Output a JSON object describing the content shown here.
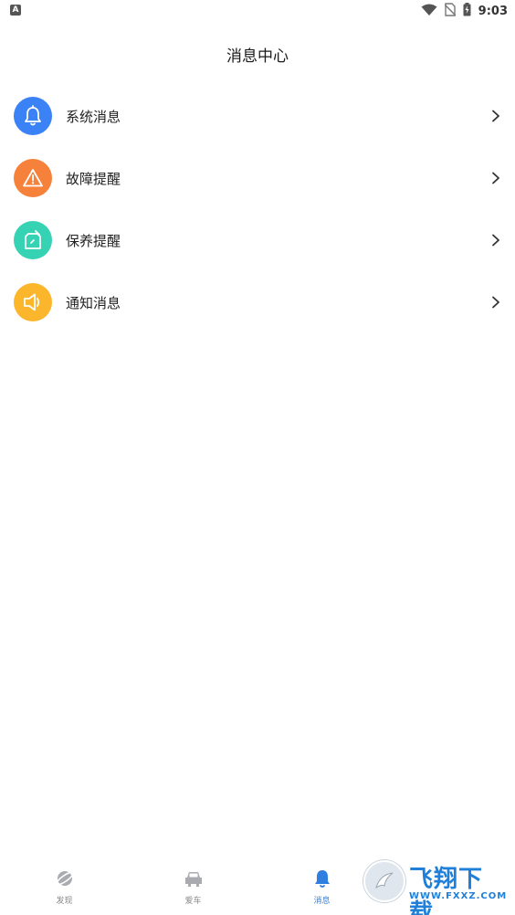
{
  "status_bar": {
    "left_badge": "A",
    "time": "9:03"
  },
  "header": {
    "title": "消息中心"
  },
  "menu": {
    "items": [
      {
        "label": "系统消息",
        "icon": "bell-icon",
        "color": "#3b82f6"
      },
      {
        "label": "故障提醒",
        "icon": "warning-icon",
        "color": "#f6813a"
      },
      {
        "label": "保养提醒",
        "icon": "maintenance-icon",
        "color": "#35d2b4"
      },
      {
        "label": "通知消息",
        "icon": "speaker-icon",
        "color": "#fbb62c"
      }
    ]
  },
  "tab_bar": {
    "tabs": [
      {
        "label": "发现",
        "icon": "planet-icon",
        "active": false
      },
      {
        "label": "爱车",
        "icon": "car-icon",
        "active": false
      },
      {
        "label": "消息",
        "icon": "bell-icon",
        "active": true
      }
    ]
  },
  "watermark": {
    "text": "飞翔下载",
    "url": "WWW.FXXZ.COM"
  },
  "colors": {
    "accent": "#2f7fe0",
    "inactive": "#888888"
  }
}
